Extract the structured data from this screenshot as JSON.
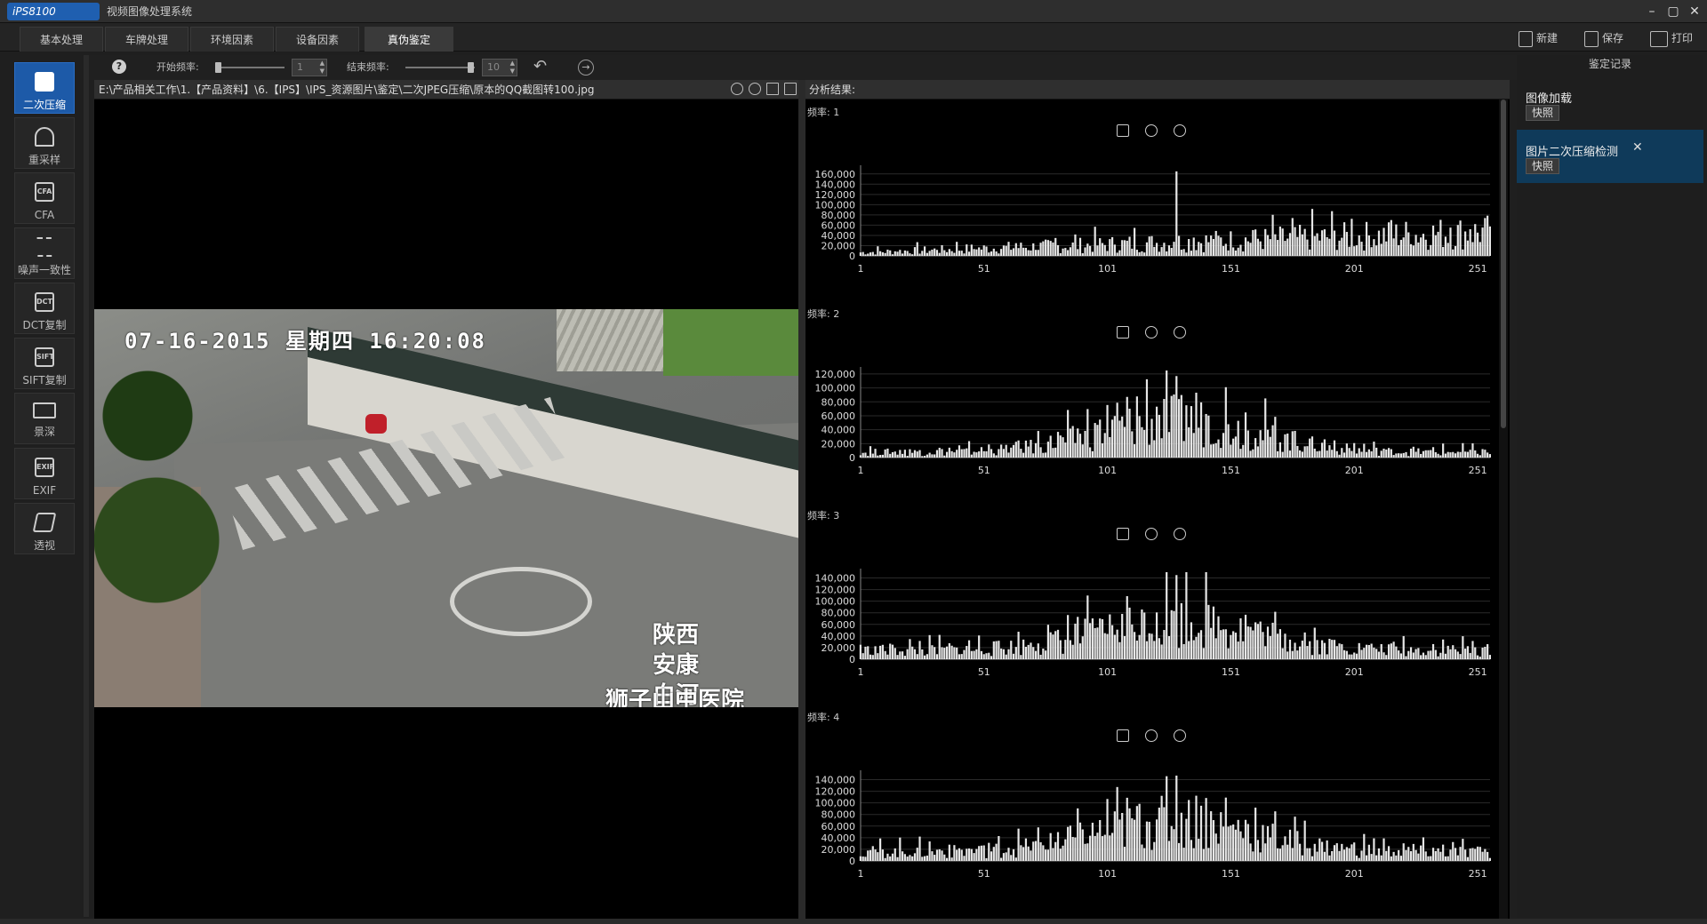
{
  "window": {
    "logo_text": "iPS8100",
    "title": "视频图像处理系统",
    "controls": [
      "–",
      "▢",
      "✕"
    ]
  },
  "tabs": [
    {
      "label": "基本处理",
      "active": false
    },
    {
      "label": "车牌处理",
      "active": false
    },
    {
      "label": "环境因素",
      "active": false
    },
    {
      "label": "设备因素",
      "active": false
    },
    {
      "label": "真伪鉴定",
      "active": true
    }
  ],
  "top_actions": {
    "new": "新建",
    "save": "保存",
    "print": "打印"
  },
  "toolbar": {
    "start_freq_label": "开始频率:",
    "start_freq_value": "1",
    "end_freq_label": "结束频率:",
    "end_freq_value": "10"
  },
  "sidebar": {
    "items": [
      {
        "label": "二次压缩",
        "glyph": "doc-icon",
        "active": true
      },
      {
        "label": "重采样",
        "glyph": "pin-icon",
        "active": false
      },
      {
        "label": "CFA",
        "glyph": "CFA",
        "active": false
      },
      {
        "label": "噪声一致性",
        "glyph": "noise-icon",
        "active": false
      },
      {
        "label": "DCT复制",
        "glyph": "DCT",
        "active": false
      },
      {
        "label": "SIFT复制",
        "glyph": "SIFT",
        "active": false
      },
      {
        "label": "景深",
        "glyph": "depth-icon",
        "active": false
      },
      {
        "label": "EXIF",
        "glyph": "EXIF",
        "active": false
      },
      {
        "label": "透视",
        "glyph": "perspective-icon",
        "active": false
      }
    ]
  },
  "image_panel": {
    "path": "E:\\产品相关工作\\1.【产品资料】\\6.【IPS】\\IPS_资源图片\\鉴定\\二次JPEG压缩\\原本的QQ截图转100.jpg",
    "overlay_time": "07-16-2015 星期四 16:20:08",
    "overlay_location_1": "陕西",
    "overlay_location_2": "安康",
    "overlay_location_3": "白河",
    "overlay_location_4": "狮子山中医院"
  },
  "analysis_panel": {
    "header": "分析结果:",
    "freq_prefix": "频率:"
  },
  "chart_data": [
    {
      "type": "bar",
      "freq_label": "频率: 1",
      "x_ticks": [
        1,
        51,
        101,
        151,
        201,
        251
      ],
      "y_ticks": [
        0,
        20000,
        40000,
        60000,
        80000,
        100000,
        120000,
        140000,
        160000
      ],
      "ylim": [
        0,
        170000
      ],
      "xlim": [
        1,
        256
      ],
      "peak": {
        "x": 129,
        "y": 165000
      },
      "envelope": "rising",
      "base_level": 8000,
      "tail_level": 55000
    },
    {
      "type": "bar",
      "freq_label": "频率: 2",
      "x_ticks": [
        1,
        51,
        101,
        151,
        201,
        251
      ],
      "y_ticks": [
        0,
        20000,
        40000,
        60000,
        80000,
        100000,
        120000
      ],
      "ylim": [
        0,
        125000
      ],
      "xlim": [
        1,
        256
      ],
      "peak": {
        "x": 129,
        "y": 117000
      },
      "envelope": "bell",
      "base_level": 10000,
      "tail_level": 10000
    },
    {
      "type": "bar",
      "freq_label": "频率: 3",
      "x_ticks": [
        1,
        51,
        101,
        151,
        201,
        251
      ],
      "y_ticks": [
        0,
        20000,
        40000,
        60000,
        80000,
        100000,
        120000,
        140000
      ],
      "ylim": [
        0,
        150000
      ],
      "xlim": [
        1,
        256
      ],
      "peak": {
        "x": 129,
        "y": 145000
      },
      "envelope": "bell",
      "base_level": 20000,
      "tail_level": 20000
    },
    {
      "type": "bar",
      "freq_label": "频率: 4",
      "x_ticks": [
        1,
        51,
        101,
        151,
        201,
        251
      ],
      "y_ticks": [
        0,
        20000,
        40000,
        60000,
        80000,
        100000,
        120000,
        140000
      ],
      "ylim": [
        0,
        150000
      ],
      "xlim": [
        1,
        256
      ],
      "peak": {
        "x": 129,
        "y": 147000
      },
      "envelope": "bell",
      "base_level": 20000,
      "tail_level": 20000
    }
  ],
  "right_panel": {
    "title": "鉴定记录",
    "records": [
      {
        "name": "图像加载",
        "snapshot": "快照",
        "selected": false
      },
      {
        "name": "图片二次压缩检测",
        "snapshot": "快照",
        "selected": true,
        "close": "✕"
      }
    ]
  }
}
